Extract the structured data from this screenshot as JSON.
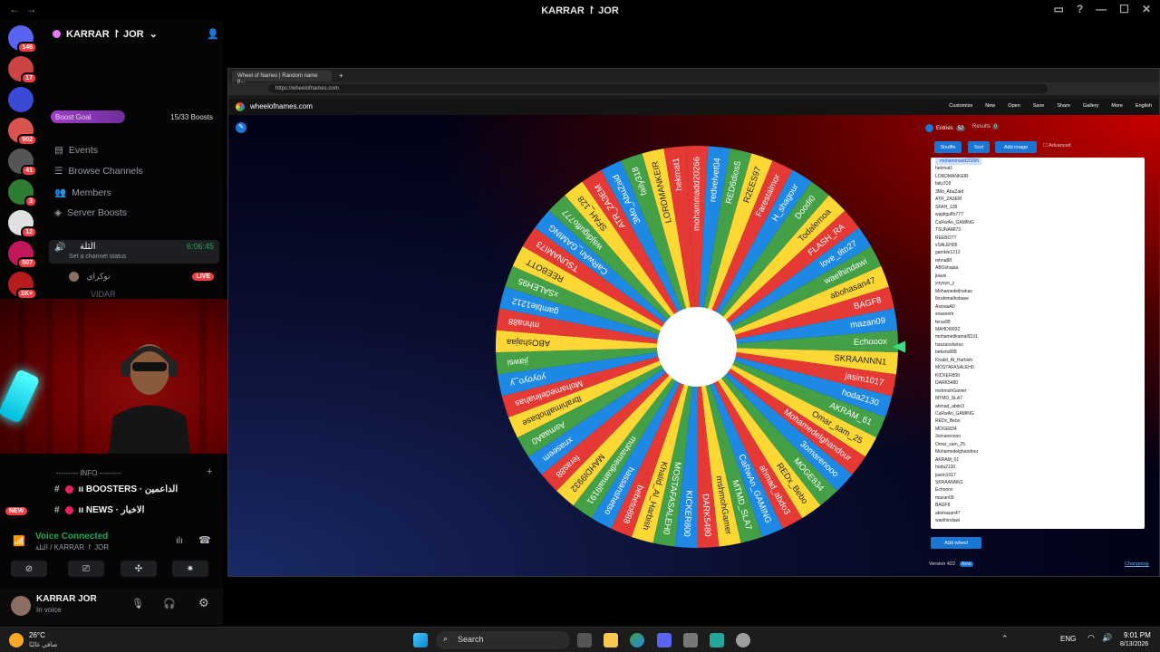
{
  "window": {
    "title": "KARRAR ↾ JOR"
  },
  "discord": {
    "guilds": [
      {
        "badge": "146",
        "color": "#5865f2"
      },
      {
        "badge": "17",
        "color": "#c44"
      },
      {
        "badge": "",
        "color": "#3a4ad6"
      },
      {
        "badge": "902",
        "color": "#d9534f"
      },
      {
        "badge": "41",
        "color": "#555"
      },
      {
        "badge": "3",
        "color": "#2e7d32"
      },
      {
        "badge": "12",
        "color": "#e0e0e0"
      },
      {
        "badge": "507",
        "color": "#c2185b"
      },
      {
        "badge": "1K+",
        "color": "#b71c1c"
      }
    ],
    "server_name": "KARRAR ↾ JOR",
    "boost_goal": {
      "label": "Boost Goal",
      "count": "15/33 Boosts",
      "progress": 0.4545
    },
    "nav": [
      "Events",
      "Browse Channels",
      "Members",
      "Server Boosts"
    ],
    "voice_channel": {
      "name": "الثلة",
      "status": "Set a channel status",
      "time": "6:06:45"
    },
    "voice_user": "توكراي",
    "voice_user2": "VIDAR",
    "live_label": "LIVE",
    "category": "--------- INFO ---------",
    "channels": [
      "ıı BOOSTERS · الداعمين",
      "ıı NEWS · الاخبار"
    ],
    "voice_connected": "Voice Connected",
    "voice_location": "الثلة / KARRAR ↾ JOR",
    "user_name": "KARRAR JOR",
    "user_status": "In voice",
    "new_badge": "NEW"
  },
  "browser": {
    "tab_title": "Wheel of Names | Random name p...",
    "url": "https://wheelofnames.com",
    "site_name": "wheelofnames.com",
    "menu": [
      "Customize",
      "New",
      "Open",
      "Save",
      "Share",
      "Gallery",
      "More",
      "English"
    ],
    "tabs": [
      {
        "label": "Entries",
        "count": "52"
      },
      {
        "label": "Results",
        "count": "0"
      }
    ],
    "buttons": {
      "shuffle": "Shuffle",
      "sort": "Sort",
      "add_image": "Add image",
      "advanced": "Advanced",
      "add_wheel": "Add wheel"
    },
    "version": "Version 422",
    "new_label": "New",
    "changelog": "Changelog",
    "entries": [
      "mohammadd20266",
      "hekmat1",
      "LORDMANKEIR",
      "faily318",
      "3Mo_AbuZaid",
      "ATR_ZA3EM",
      "SFAH_128",
      "wajdiguffo777",
      "CaRwAn_GAMING",
      "TSUNAMI73",
      "REEBOTT",
      "xSALEH95",
      "gamble1212",
      "mhna88",
      "ABOshajaa",
      "jiawsi",
      "yoyoyo_y",
      "Mohamedelinahas",
      "Ibrahimalhobase",
      "AsmaaA0",
      "xnaseem",
      "feras88",
      "MAHDI9932",
      "mohamedkamal9191",
      "hassanshetso",
      "bebeto888",
      "Khalid_Al_Harbish",
      "MOSTAFASALEH0",
      "KICKER800",
      "DARK5480",
      "mshmohGamer",
      "MTMD_SLA7",
      "ahmad_abdo3",
      "CaRwAn_GAMING",
      "REDx_Bebo",
      "MOGE834",
      "3omarenooo",
      "Omar_sam_25",
      "Mohamedelghandour",
      "AKRAM_61",
      "hoda2130",
      "jasim1017",
      "SKRAANNN1",
      "Echooox",
      "mazan09",
      "BAGF8",
      "abohasan47",
      "waelhindawi"
    ],
    "wheel_labels": [
      "mohammadd20266",
      "redvelvet04",
      "RED6dios5",
      "R2EES97",
      "Farestalmor",
      "H_shagour",
      "Doodi0",
      "Todalemoa",
      "FLASH_RA",
      "love_tito27",
      "waelhindawi",
      "abohasan47",
      "BAGF8",
      "mazan09",
      "Echooox",
      "SKRAANNN1",
      "jasim1017",
      "hoda2130",
      "AKRAM_61",
      "Omar_sam_25",
      "Mohamedelghandour",
      "3omarenooo",
      "MOGE834",
      "REDx_Bebo",
      "ahmad_abdo3",
      "CaRwAn_GAMING",
      "MTMD_SLA7",
      "mshmohGamer",
      "DARK5480",
      "KICKER800",
      "MOSTAFASALEH0",
      "Khalid_Al_Harbish",
      "bebeto888",
      "hassanshetso",
      "mohamedkamal9191",
      "MAHDI9932",
      "feras88",
      "xnaseem",
      "AsmaaA0",
      "Ibrahimalhobase",
      "Mohamedelinahas",
      "yoyoyo_y",
      "jiawsi",
      "ABOshajaa",
      "mhna88",
      "gamble1212",
      "xSALEH95",
      "REEBOTT",
      "TSUNAMI73",
      "CaRwAn_GAMING",
      "wajdiguffo777",
      "SFAH_128",
      "ATR_ZA3EM",
      "3Mo_AbuZaid",
      "faily318",
      "LORDMANKEIR",
      "hekmat1"
    ],
    "wheel_colors": [
      "#e53935",
      "#1e88e5",
      "#43a047",
      "#fdd835"
    ]
  },
  "taskbar": {
    "weather_temp": "26°C",
    "weather_desc": "صافي غالبًا",
    "search": "Search",
    "lang": "ENG",
    "time": "9:01 PM",
    "date": "8/13/2026"
  }
}
